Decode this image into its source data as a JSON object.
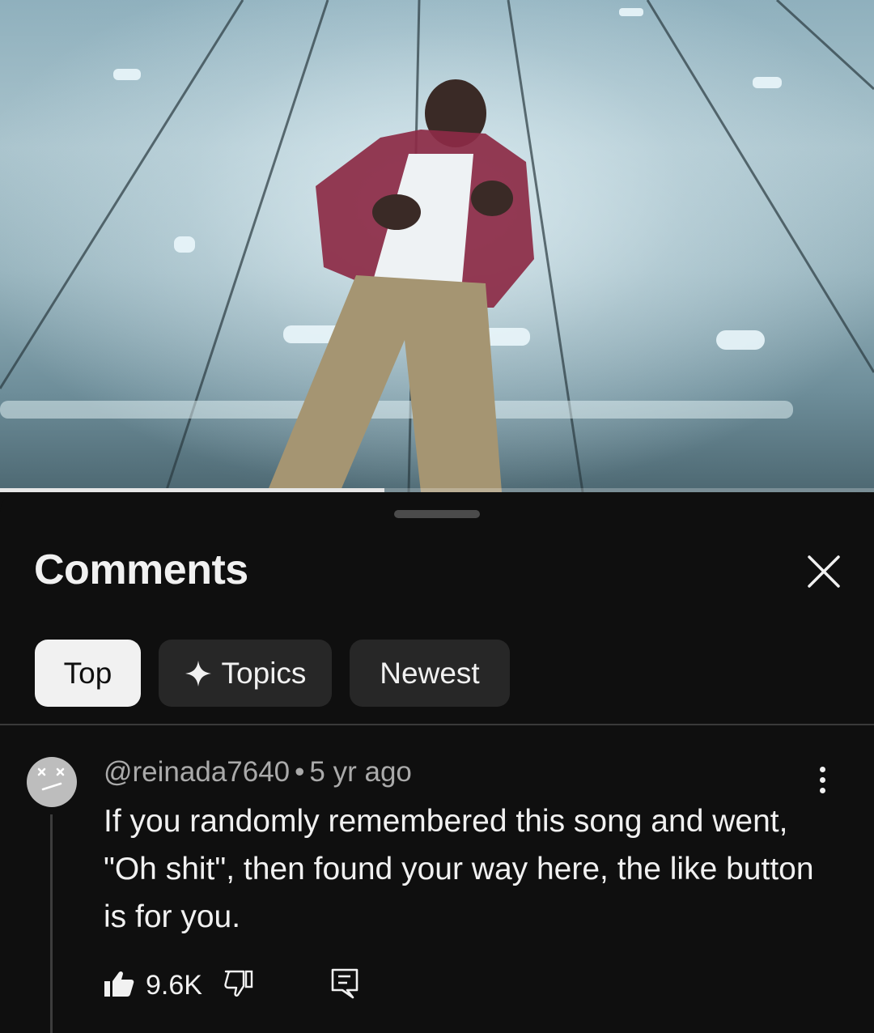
{
  "video": {
    "progress_fraction": 0.44
  },
  "sheet": {
    "title": "Comments",
    "close_icon": "close-icon"
  },
  "filters": {
    "top": "Top",
    "topics": "Topics",
    "topics_icon": "sparkle-icon",
    "newest": "Newest"
  },
  "comments": [
    {
      "author": "@reinada7640",
      "separator": "•",
      "time": "5 yr ago",
      "text": "If you randomly remembered this song and went, \"Oh shit\", then found your way here, the like button is for you.",
      "likes": "9.6K"
    }
  ],
  "colors": {
    "background": "#0f0f0f",
    "chip_selected": "#f1f1f1",
    "chip": "#272727",
    "secondary_text": "#aaaaaa"
  }
}
